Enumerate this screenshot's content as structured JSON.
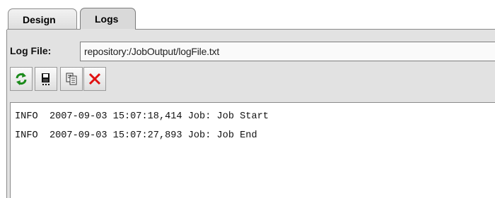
{
  "tabs": [
    {
      "label": "Design",
      "active": false
    },
    {
      "label": "Logs",
      "active": true
    }
  ],
  "log_file": {
    "label": "Log File:",
    "value": "repository:/JobOutput/logFile.txt"
  },
  "toolbar": {
    "buttons": [
      {
        "icon": "refresh-icon"
      },
      {
        "icon": "save-icon"
      },
      {
        "icon": "copy-icon"
      },
      {
        "icon": "delete-icon"
      }
    ]
  },
  "log": {
    "lines": [
      "INFO  2007-09-03 15:07:18,414 Job: Job Start",
      "INFO  2007-09-03 15:07:27,893 Job: Job End"
    ]
  },
  "colors": {
    "panel": "#e2e2e2",
    "delete_red": "#e01010",
    "refresh_green": "#1a8a1a"
  }
}
